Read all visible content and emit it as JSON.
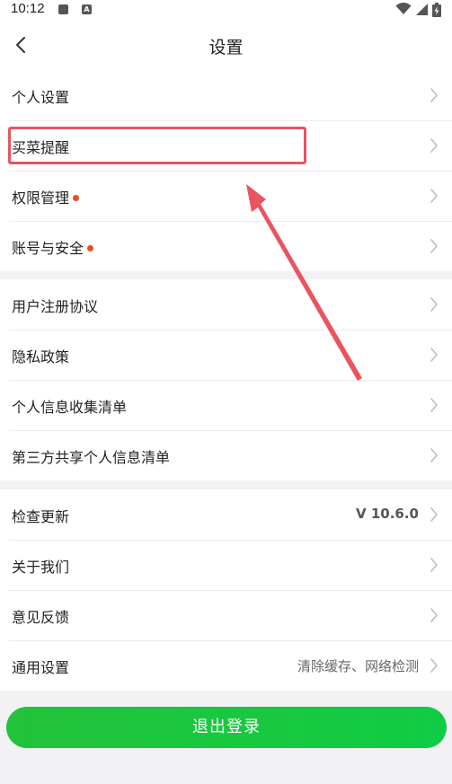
{
  "status_bar": {
    "time": "10:12",
    "a_badge": "A"
  },
  "header": {
    "title": "设置"
  },
  "groups": [
    {
      "items": [
        {
          "label": "个人设置",
          "dot": false
        },
        {
          "label": "买菜提醒",
          "dot": false
        },
        {
          "label": "权限管理",
          "dot": true
        },
        {
          "label": "账号与安全",
          "dot": true
        }
      ]
    },
    {
      "items": [
        {
          "label": "用户注册协议"
        },
        {
          "label": "隐私政策"
        },
        {
          "label": "个人信息收集清单"
        },
        {
          "label": "第三方共享个人信息清单"
        }
      ]
    },
    {
      "items": [
        {
          "label": "检查更新",
          "value": "V 10.6.0"
        },
        {
          "label": "关于我们"
        },
        {
          "label": "意见反馈"
        },
        {
          "label": "通用设置",
          "value": "清除缓存、网络检测"
        }
      ]
    }
  ],
  "logout": {
    "label": "退出登录"
  },
  "colors": {
    "accent_green": "#1fc43c",
    "dot_red": "#f04a1f",
    "annotation_red": "#e9545f",
    "background": "#f2f2f5"
  }
}
